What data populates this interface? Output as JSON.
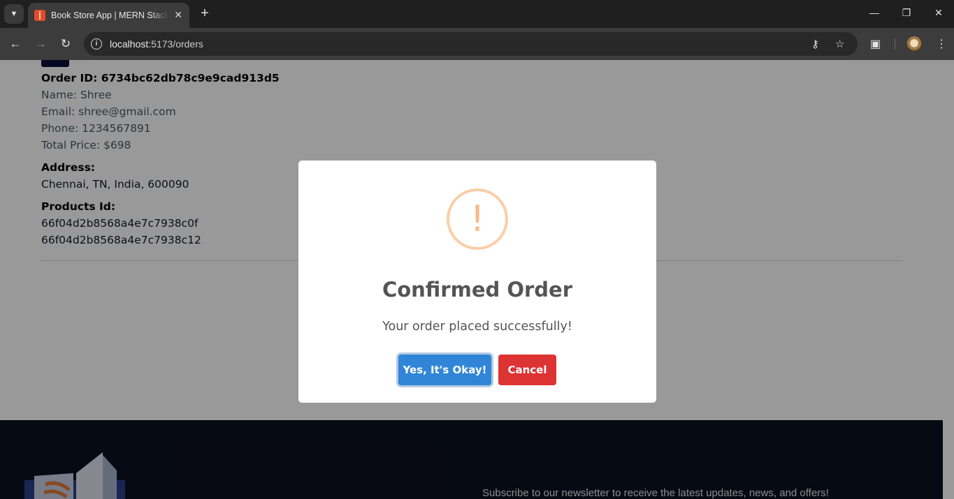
{
  "browser": {
    "tab_title": "Book Store App | MERN Stack Project",
    "url_host": "localhost",
    "url_path": ":5173/orders"
  },
  "order": {
    "id_label": "Order ID: 6734bc62db78c9e9cad913d5",
    "name": "Name: Shree",
    "email": "Email: shree@gmail.com",
    "phone": "Phone: 1234567891",
    "total": "Total Price: $698",
    "address_heading": "Address:",
    "address": "Chennai, TN, India, 600090",
    "products_heading": "Products Id:",
    "products": [
      "66f04d2b8568a4e7c7938c0f",
      "66f04d2b8568a4e7c7938c12"
    ]
  },
  "footer": {
    "newsletter_text": "Subscribe to our newsletter to receive the latest updates, news, and offers!"
  },
  "modal": {
    "icon": "!",
    "title": "Confirmed Order",
    "text": "Your order placed successfully!",
    "confirm_label": "Yes, It's Okay!",
    "cancel_label": "Cancel"
  }
}
